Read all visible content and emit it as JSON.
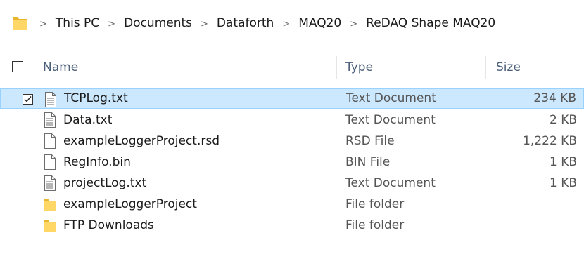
{
  "breadcrumb": {
    "icon": "folder-icon",
    "items": [
      "This PC",
      "Documents",
      "Dataforth",
      "MAQ20",
      "ReDAQ Shape MAQ20"
    ]
  },
  "columns": {
    "name": "Name",
    "type": "Type",
    "size": "Size"
  },
  "files": [
    {
      "name": "TCPLog.txt",
      "type": "Text Document",
      "size": "234 KB",
      "icon": "text-document-icon",
      "selected": true
    },
    {
      "name": "Data.txt",
      "type": "Text Document",
      "size": "2 KB",
      "icon": "text-document-icon",
      "selected": false
    },
    {
      "name": "exampleLoggerProject.rsd",
      "type": "RSD File",
      "size": "1,222 KB",
      "icon": "blank-file-icon",
      "selected": false
    },
    {
      "name": "RegInfo.bin",
      "type": "BIN File",
      "size": "1 KB",
      "icon": "blank-file-icon",
      "selected": false
    },
    {
      "name": "projectLog.txt",
      "type": "Text Document",
      "size": "1 KB",
      "icon": "text-document-icon",
      "selected": false
    },
    {
      "name": "exampleLoggerProject",
      "type": "File folder",
      "size": "",
      "icon": "folder-icon",
      "selected": false
    },
    {
      "name": "FTP Downloads",
      "type": "File folder",
      "size": "",
      "icon": "folder-icon",
      "selected": false
    }
  ],
  "colors": {
    "selection_bg": "#cce8ff",
    "selection_border": "#99d1ff",
    "folder": "#ffd766",
    "header_text": "#4c607a"
  }
}
